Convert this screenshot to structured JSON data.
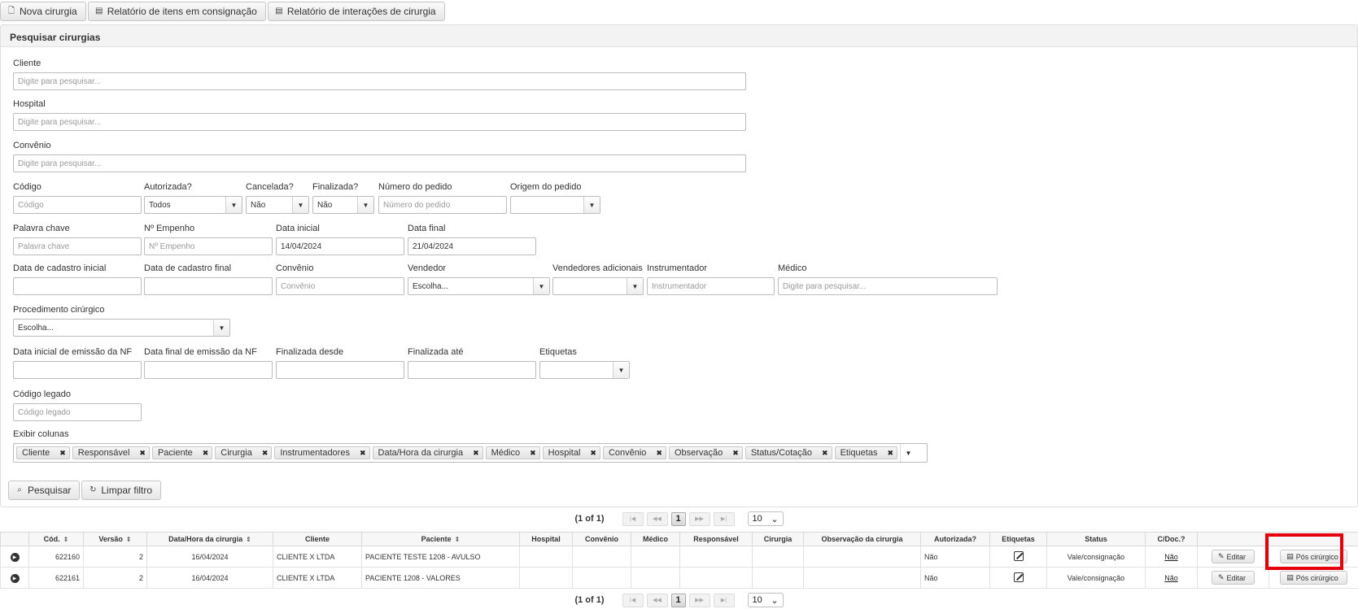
{
  "toolbar": {
    "nova_cirurgia": "Nova cirurgia",
    "relatorio_consignacao": "Relatório de itens em consignação",
    "relatorio_interacoes": "Relatório de interações de cirurgia"
  },
  "search": {
    "title": "Pesquisar cirurgias",
    "cliente": {
      "label": "Cliente",
      "placeholder": "Digite para pesquisar..."
    },
    "hospital": {
      "label": "Hospital",
      "placeholder": "Digite para pesquisar..."
    },
    "convenio": {
      "label": "Convênio",
      "placeholder": "Digite para pesquisar..."
    },
    "codigo": {
      "label": "Código",
      "placeholder": "Código"
    },
    "autorizada": {
      "label": "Autorizada?",
      "value": "Todos"
    },
    "cancelada": {
      "label": "Cancelada?",
      "value": "Não"
    },
    "finalizada": {
      "label": "Finalizada?",
      "value": "Não"
    },
    "numero_pedido": {
      "label": "Número do pedido",
      "placeholder": "Número do pedido"
    },
    "origem_pedido": {
      "label": "Origem do pedido",
      "value": ""
    },
    "palavra_chave": {
      "label": "Palavra chave",
      "placeholder": "Palavra chave"
    },
    "empenho": {
      "label": "Nº Empenho",
      "placeholder": "Nº Empenho"
    },
    "data_inicial": {
      "label": "Data inicial",
      "value": "14/04/2024"
    },
    "data_final": {
      "label": "Data final",
      "value": "21/04/2024"
    },
    "data_cadastro_inicial": {
      "label": "Data de cadastro inicial",
      "value": ""
    },
    "data_cadastro_final": {
      "label": "Data de cadastro final",
      "value": ""
    },
    "convenio2": {
      "label": "Convênio",
      "placeholder": "Convênio"
    },
    "vendedor": {
      "label": "Vendedor",
      "value": "Escolha..."
    },
    "vendedores_adicionais": {
      "label": "Vendedores adicionais",
      "value": ""
    },
    "instrumentador": {
      "label": "Instrumentador",
      "placeholder": "Instrumentador"
    },
    "medico": {
      "label": "Médico",
      "placeholder": "Digite para pesquisar..."
    },
    "procedimento": {
      "label": "Procedimento cirúrgico",
      "value": "Escolha..."
    },
    "nf_inicial": {
      "label": "Data inicial de emissão da NF",
      "value": ""
    },
    "nf_final": {
      "label": "Data final de emissão da NF",
      "value": ""
    },
    "finalizada_desde": {
      "label": "Finalizada desde",
      "value": ""
    },
    "finalizada_ate": {
      "label": "Finalizada até",
      "value": ""
    },
    "etiquetas": {
      "label": "Etiquetas",
      "value": ""
    },
    "codigo_legado": {
      "label": "Código legado",
      "placeholder": "Código legado"
    },
    "exibir_colunas": {
      "label": "Exibir colunas",
      "chips": [
        "Cliente",
        "Responsável",
        "Paciente",
        "Cirurgia",
        "Instrumentadores",
        "Data/Hora da cirurgia",
        "Médico",
        "Hospital",
        "Convênio",
        "Observação",
        "Status/Cotação",
        "Etiquetas"
      ]
    },
    "pesquisar": "Pesquisar",
    "limpar": "Limpar filtro"
  },
  "pager": {
    "status": "(1 of 1)",
    "page": "1",
    "rows": "10"
  },
  "table": {
    "headers": [
      "Cód.",
      "Versão",
      "Data/Hora da cirurgia",
      "Cliente",
      "Paciente",
      "Hospital",
      "Convênio",
      "Médico",
      "Responsável",
      "Cirurgia",
      "Observação da cirurgia",
      "Autorizada?",
      "Etiquetas",
      "Status",
      "C/Doc.?"
    ],
    "rows": [
      {
        "cod": "622160",
        "versao": "2",
        "data": "16/04/2024",
        "cliente": "CLIENTE X LTDA",
        "paciente": "PACIENTE TESTE 1208 - AVULSO",
        "hospital": "",
        "convenio": "",
        "medico": "",
        "responsavel": "",
        "cirurgia": "",
        "obs": "",
        "autorizada": "Não",
        "status": "Vale/consignação",
        "cdoc": "Não",
        "editar": "Editar",
        "pos": "Pós cirúrgico"
      },
      {
        "cod": "622161",
        "versao": "2",
        "data": "16/04/2024",
        "cliente": "CLIENTE X LTDA",
        "paciente": "PACIENTE 1208 - VALORES",
        "hospital": "",
        "convenio": "",
        "medico": "",
        "responsavel": "",
        "cirurgia": "",
        "obs": "",
        "autorizada": "Não",
        "status": "Vale/consignação",
        "cdoc": "Não",
        "editar": "Editar",
        "pos": "Pós cirúrgico"
      }
    ]
  }
}
